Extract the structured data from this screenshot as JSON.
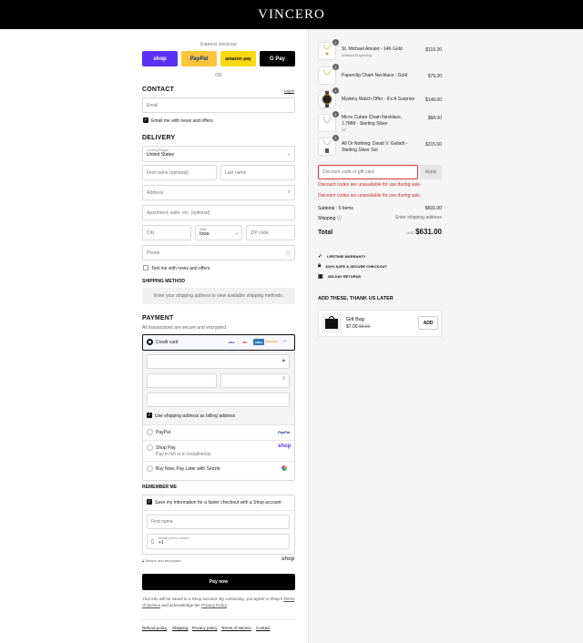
{
  "brand": "VINCERO",
  "express": {
    "label": "Express checkout",
    "or": "OR",
    "buttons": [
      "shop",
      "PayPal",
      "amazon pay",
      "G Pay"
    ]
  },
  "contact": {
    "title": "CONTACT",
    "login": "Log in",
    "email_placeholder": "Email",
    "news": "Email me with news and offers"
  },
  "delivery": {
    "title": "DELIVERY",
    "country_label": "Country/Region",
    "country": "United States",
    "first": "First name (optional)",
    "last": "Last name",
    "address": "Address",
    "apt": "Apartment, suite, etc. (optional)",
    "city": "City",
    "state_label": "State",
    "state": "Iowa",
    "zip": "ZIP code",
    "phone": "Phone",
    "text_me": "Text me with news and offers"
  },
  "shipping": {
    "title": "SHIPPING METHOD",
    "note": "Enter your shipping address to view available shipping methods."
  },
  "payment": {
    "title": "PAYMENT",
    "sub": "All transactions are secure and encrypted.",
    "credit": "Credit card",
    "cards": [
      "VISA",
      "MC",
      "AMEX",
      "DISCOVER"
    ],
    "more": "→",
    "billing": "Use shipping address as billing address",
    "paypal": "PayPal",
    "paypal_logo": "PayPal",
    "shoppay": "Shop Pay",
    "shoppay_sub": "Pay in full or in installments",
    "shoppay_logo": "shop",
    "sezzle": "Buy Now, Pay Later with Sezzle"
  },
  "remember": {
    "title": "REMEMBER ME",
    "save": "Save my information for a faster checkout with a Shop account",
    "first": "First name",
    "mobile_label": "Mobile phone number",
    "mobile": "+1",
    "secure": "Secure and encrypted",
    "shop": "shop"
  },
  "paynow": "Pay now",
  "disclaimer": {
    "text": "Your info will be saved to a Shop account. By continuing, you agree to Shop's",
    "tos": "Terms of Service",
    "mid": "and acknowledge the",
    "privacy": "Privacy Policy",
    "end": "."
  },
  "footer": [
    "Refund policy",
    "Shipping",
    "Privacy policy",
    "Terms of service",
    "Contact"
  ],
  "cart": {
    "items": [
      {
        "qty": "1",
        "name": "St. Michael Amulet - 14K Gold",
        "sub": "Without Engraving",
        "price": "$119.20"
      },
      {
        "qty": "1",
        "name": "Paperclip Chain Necklace - Gold",
        "sub": "",
        "price": "$79.20"
      },
      {
        "qty": "1",
        "name": "Mystery Watch Offer - It's A Surprise",
        "sub": "",
        "price": "$149.00"
      },
      {
        "qty": "1",
        "name": "Micro Cuban Chain Necklace, 1.7MM - Sterling Silver",
        "sub": "22\"",
        "price": "$68.00"
      },
      {
        "qty": "1",
        "name": "All Or Nothing: David V. Goliath - Sterling Silver Set",
        "sub": "",
        "price": "$215.60"
      }
    ],
    "discount_placeholder": "Discount code or gift card",
    "apply": "Apply",
    "err1": "Discount codes are unavailable for use during sale.",
    "err2": "Discount codes are unavailable for use during sale.",
    "subtotal_label": "Subtotal · 5 items",
    "subtotal": "$631.00",
    "shipping_label": "Shipping",
    "shipping": "Enter shipping address",
    "total_label": "Total",
    "currency": "USD",
    "total": "$631.00",
    "usps": [
      "LIFETIME WARRANTY",
      "100% SAFE & SECURE CHECKOUT",
      "365-DAY RETURNS"
    ],
    "upsell_title": "ADD THESE, THANK US LATER",
    "upsell": {
      "name": "Gift Bag",
      "price": "$7.00",
      "old": "$8.00",
      "add": "ADD"
    }
  }
}
